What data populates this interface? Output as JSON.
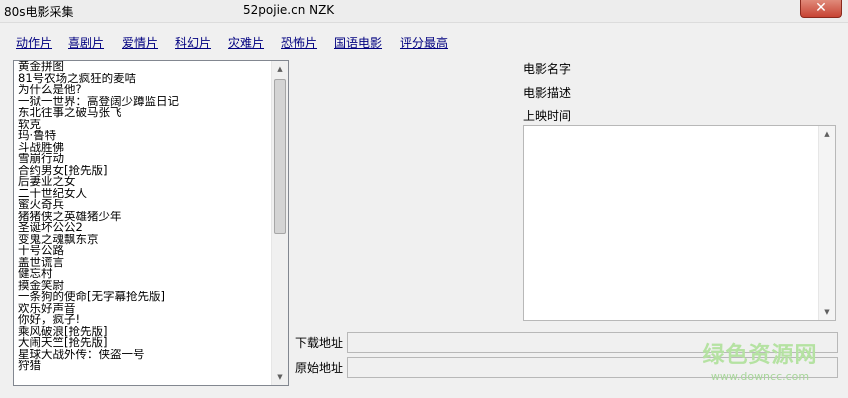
{
  "window": {
    "title": "80s电影采集",
    "subtitle": "52pojie.cn  NZK",
    "close_label": "✕"
  },
  "nav": {
    "items": [
      {
        "label": "动作片"
      },
      {
        "label": "喜剧片"
      },
      {
        "label": "爱情片"
      },
      {
        "label": "科幻片"
      },
      {
        "label": "灾难片"
      },
      {
        "label": "恐怖片"
      },
      {
        "label": "国语电影"
      },
      {
        "label": "评分最高"
      }
    ]
  },
  "movie_list": {
    "items": [
      "黄金拼图",
      "81号农场之疯狂的麦咭",
      "为什么是他?",
      "一狱一世界：高登阔少蹲监日记",
      "东北往事之破马张飞",
      "软克",
      "玛·鲁特",
      "斗战胜佛",
      "雪崩行动",
      "合约男女[抢先版]",
      "后妻业之女",
      "二十世纪女人",
      "蜜火奇兵",
      "猪猪侠之英雄猪少年",
      "圣诞坏公公2",
      "变鬼之魂飘东京",
      "十号公路",
      "盖世谎言",
      "健忘村",
      "摸金笑尉",
      "一条狗的使命[无字幕抢先版]",
      "欢乐好声音",
      "你好，疯子!",
      "乘风破浪[抢先版]",
      "大闹天竺[抢先版]",
      "星球大战外传：侠盗一号",
      "狩猎"
    ]
  },
  "details": {
    "name_label": "电影名字",
    "desc_label": "电影描述",
    "release_label": "上映时间",
    "download_label": "下载地址",
    "original_label": "原始地址",
    "download_value": "",
    "original_value": ""
  },
  "watermark": {
    "main": "绿色资源网",
    "sub": "www.downcc.com"
  },
  "scroll_icons": {
    "up": "up-arrow-icon",
    "down": "down-arrow-icon"
  }
}
